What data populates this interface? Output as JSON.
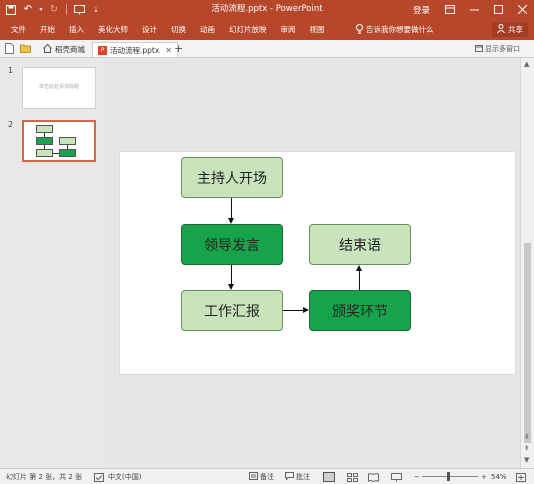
{
  "titlebar": {
    "title": "活动流程.pptx  -  PowerPoint",
    "login": "登录"
  },
  "ribbon": {
    "tabs": [
      "文件",
      "开始",
      "插入",
      "美化大师",
      "设计",
      "切换",
      "动画",
      "幻灯片放映",
      "审阅",
      "视图"
    ],
    "tell_me": "告诉我你想要做什么",
    "share": "共享"
  },
  "doc_tabs": {
    "tab1": "稻壳商城",
    "tab2": "活动流程.pptx",
    "add": "+",
    "show_multi": "显示多窗口"
  },
  "thumbnails": [
    {
      "number": "1",
      "text": "单击此处添加标题"
    },
    {
      "number": "2"
    }
  ],
  "slide": {
    "boxes": {
      "host": "主持人开场",
      "leader": "领导发言",
      "work": "工作汇报",
      "award": "颁奖环节",
      "end": "结束语"
    }
  },
  "statusbar": {
    "slide_info": "幻灯片 第 2 张，共 2 张",
    "language": "中文(中国)",
    "notes": "备注",
    "comments": "批注",
    "zoom": "54%"
  },
  "colors": {
    "accent": "#b7472a",
    "box_light": "#c9e4bd",
    "box_dark": "#16a34a"
  }
}
